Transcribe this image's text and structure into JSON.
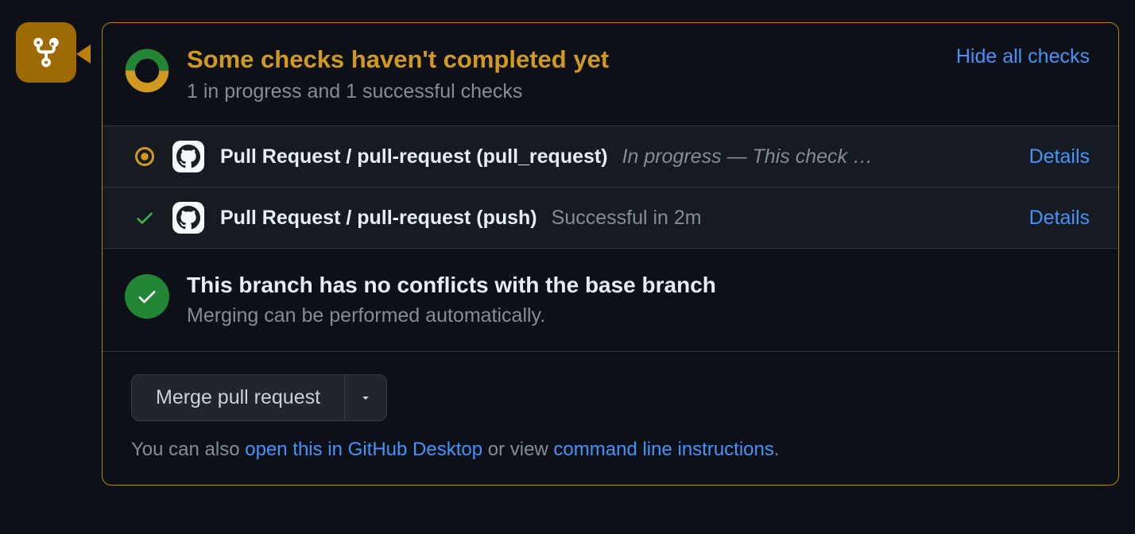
{
  "colors": {
    "pending": "#d29922",
    "success_green": "#238636",
    "link_blue": "#4493f8"
  },
  "header": {
    "title": "Some checks haven't completed yet",
    "subtitle": "1 in progress and 1 successful checks",
    "toggle_label": "Hide all checks"
  },
  "checks": [
    {
      "status": "in_progress",
      "name": "Pull Request / pull-request (pull_request)",
      "message": "In progress — This check …",
      "details_label": "Details"
    },
    {
      "status": "success",
      "name": "Pull Request / pull-request (push)",
      "message": "Successful in 2m",
      "details_label": "Details"
    }
  ],
  "merge_status": {
    "title": "This branch has no conflicts with the base branch",
    "subtitle": "Merging can be performed automatically."
  },
  "footer": {
    "merge_button_label": "Merge pull request",
    "hint_prefix": "You can also ",
    "desktop_link": "open this in GitHub Desktop",
    "hint_mid": " or view ",
    "cli_link": "command line instructions",
    "hint_suffix": "."
  }
}
